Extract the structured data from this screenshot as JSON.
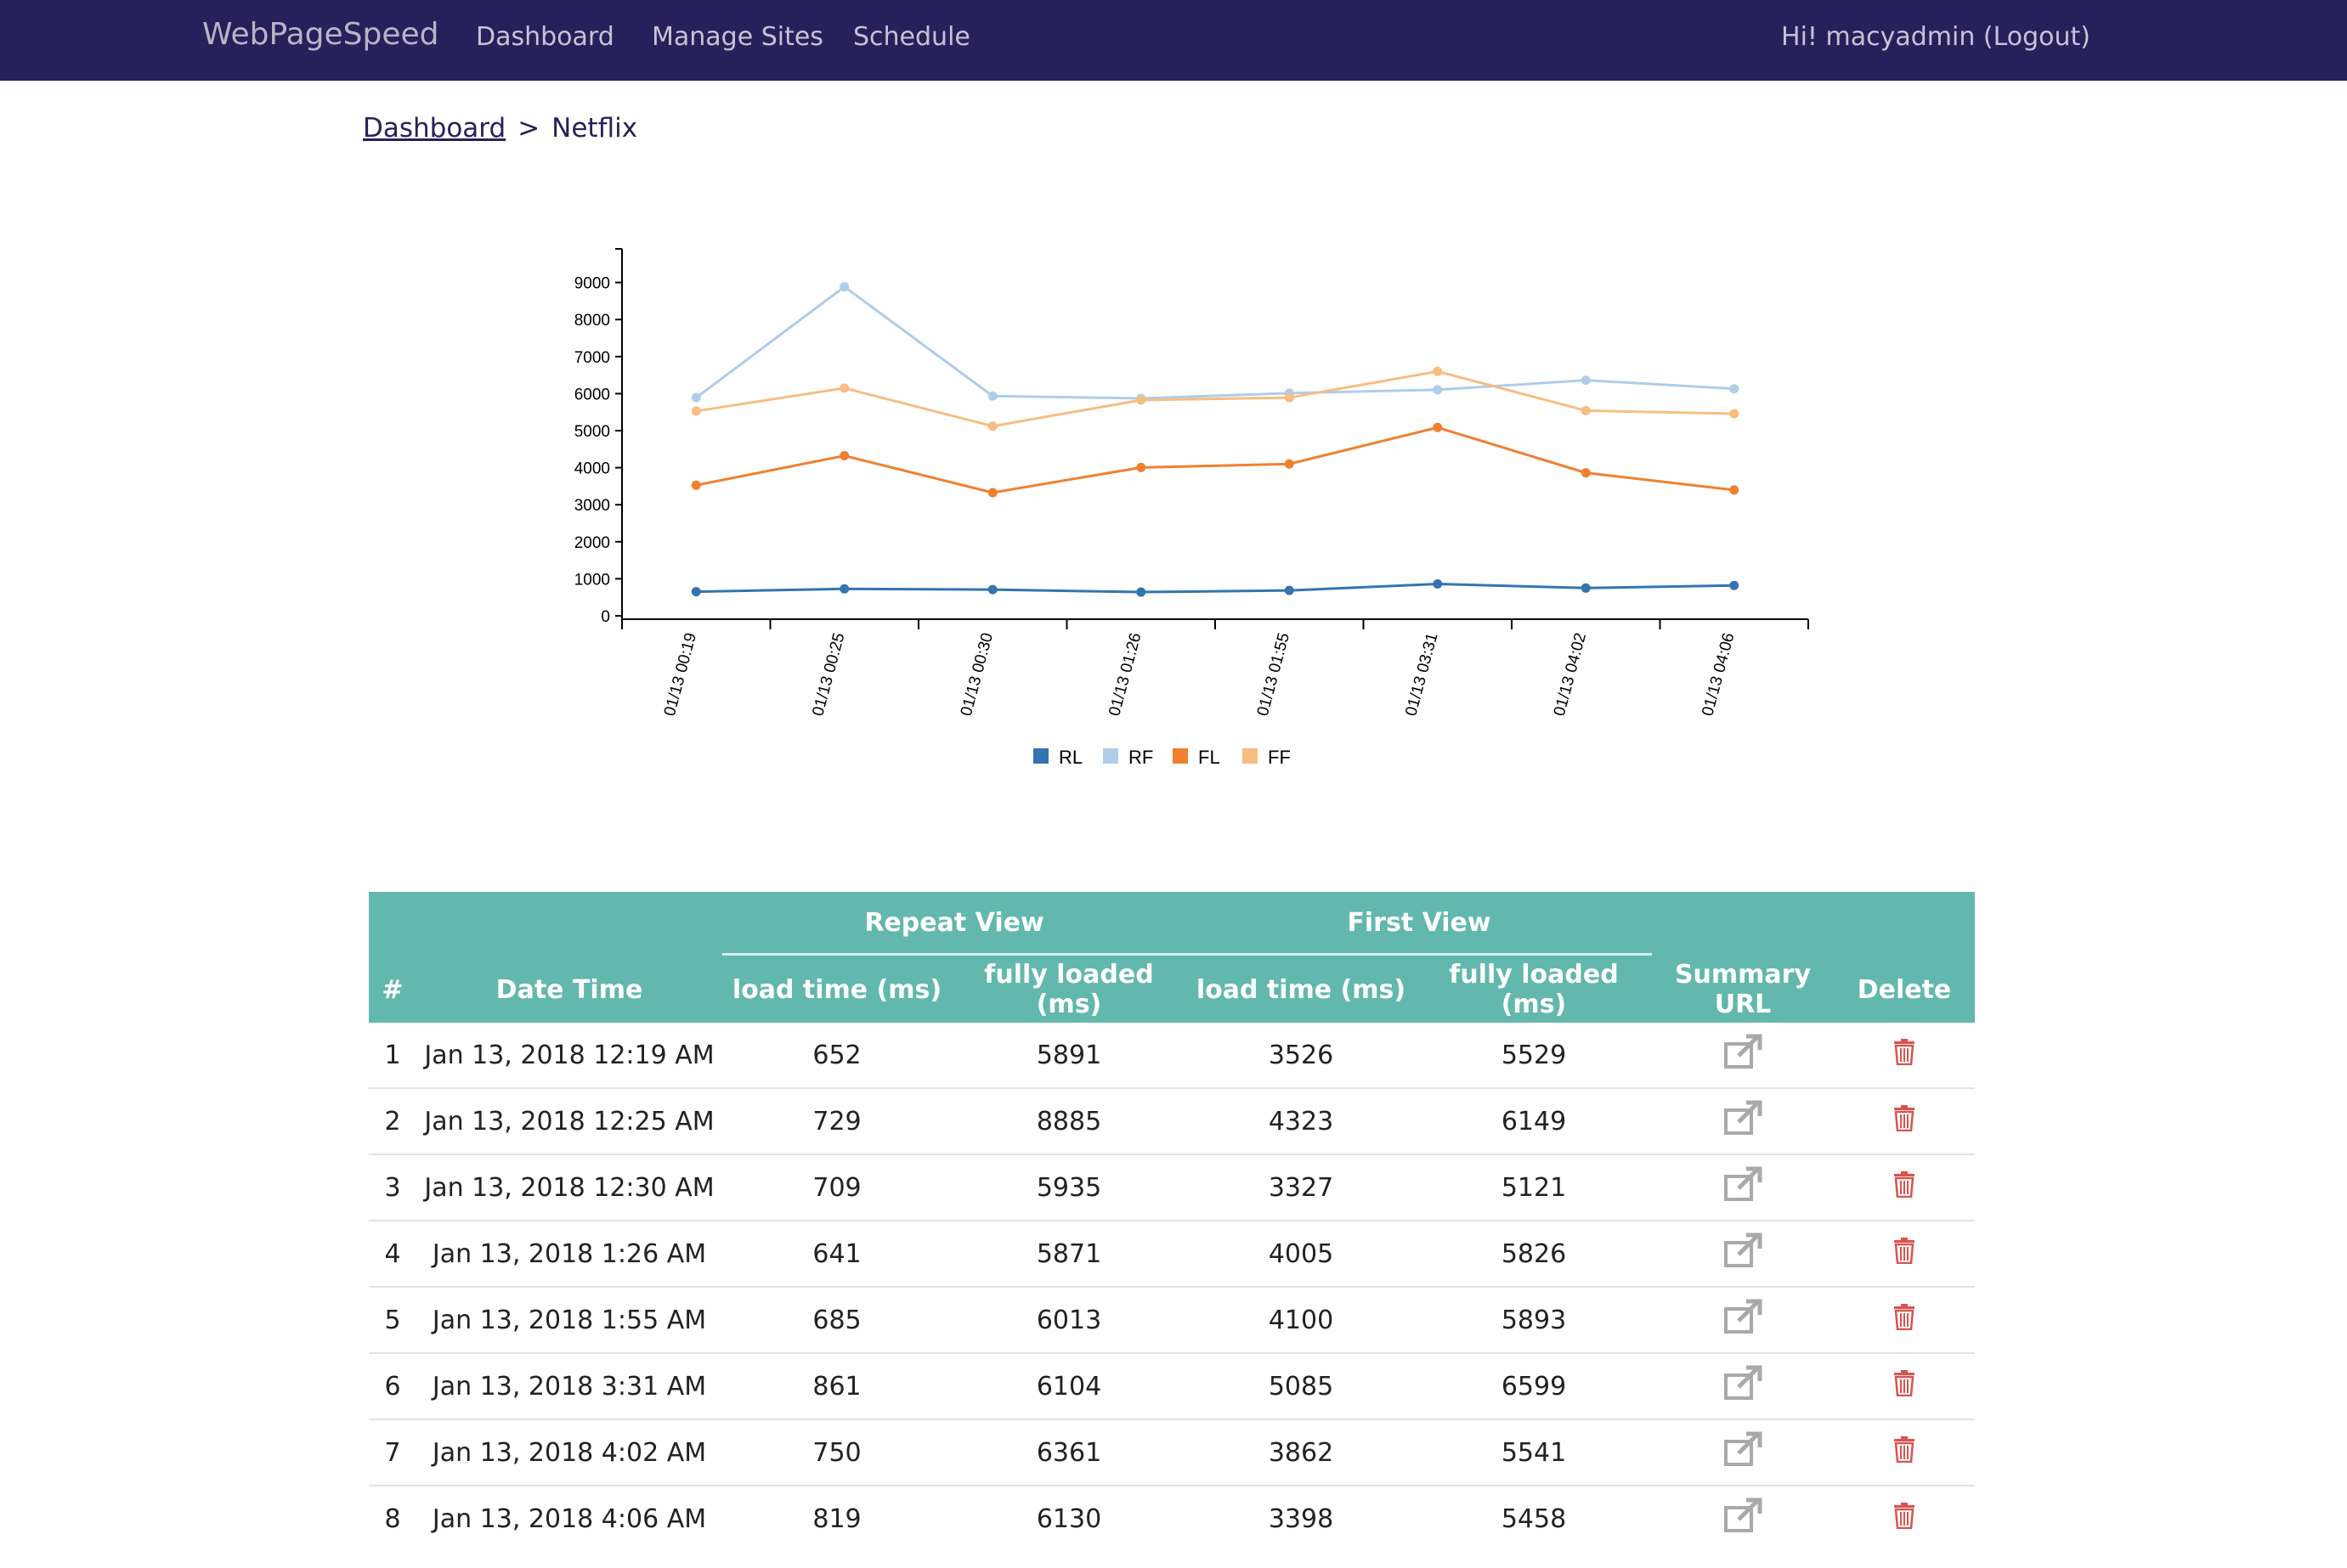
{
  "app": {
    "brand": "WebPageSpeed",
    "accent": "#28205a",
    "table_header_color": "#62b8ad",
    "delete_color": "#d9534f"
  },
  "nav": {
    "items": [
      "Dashboard",
      "Manage Sites",
      "Schedule"
    ],
    "user_text": "Hi! macyadmin (Logout)"
  },
  "breadcrumb": {
    "parent": "Dashboard",
    "separator": ">",
    "current": "Netflix"
  },
  "chart_data": {
    "type": "line",
    "x": [
      "01/13 00:19",
      "01/13 00:25",
      "01/13 00:30",
      "01/13 01:26",
      "01/13 01:55",
      "01/13 03:31",
      "01/13 04:02",
      "01/13 04:06"
    ],
    "series": [
      {
        "name": "RL",
        "color": "#3474b0",
        "values": [
          652,
          729,
          709,
          641,
          685,
          861,
          750,
          819
        ]
      },
      {
        "name": "RF",
        "color": "#aecde9",
        "values": [
          5891,
          8885,
          5935,
          5871,
          6013,
          6104,
          6361,
          6130
        ]
      },
      {
        "name": "FL",
        "color": "#f08030",
        "values": [
          3526,
          4323,
          3327,
          4005,
          4100,
          5085,
          3862,
          3398
        ]
      },
      {
        "name": "FF",
        "color": "#f7bd82",
        "values": [
          5529,
          6149,
          5121,
          5826,
          5893,
          6599,
          5541,
          5458
        ]
      }
    ],
    "y_ticks": [
      0,
      1000,
      2000,
      3000,
      4000,
      5000,
      6000,
      7000,
      8000,
      9000
    ],
    "ylim": [
      0,
      9000
    ],
    "legend_position": "bottom-center",
    "grid": false
  },
  "table": {
    "group_headers": [
      "Repeat View",
      "First View"
    ],
    "columns": [
      "#",
      "Date Time",
      "load time (ms)",
      "fully loaded (ms)",
      "load time (ms)",
      "fully loaded (ms)",
      "Summary URL",
      "Delete"
    ],
    "rows": [
      [
        "1",
        "Jan 13, 2018 12:19 AM",
        "652",
        "5891",
        "3526",
        "5529"
      ],
      [
        "2",
        "Jan 13, 2018 12:25 AM",
        "729",
        "8885",
        "4323",
        "6149"
      ],
      [
        "3",
        "Jan 13, 2018 12:30 AM",
        "709",
        "5935",
        "3327",
        "5121"
      ],
      [
        "4",
        "Jan 13, 2018 1:26 AM",
        "641",
        "5871",
        "4005",
        "5826"
      ],
      [
        "5",
        "Jan 13, 2018 1:55 AM",
        "685",
        "6013",
        "4100",
        "5893"
      ],
      [
        "6",
        "Jan 13, 2018 3:31 AM",
        "861",
        "6104",
        "5085",
        "6599"
      ],
      [
        "7",
        "Jan 13, 2018 4:02 AM",
        "750",
        "6361",
        "3862",
        "5541"
      ],
      [
        "8",
        "Jan 13, 2018 4:06 AM",
        "819",
        "6130",
        "3398",
        "5458"
      ]
    ],
    "summary_icon": "external-link-icon",
    "delete_icon": "trash-icon"
  }
}
